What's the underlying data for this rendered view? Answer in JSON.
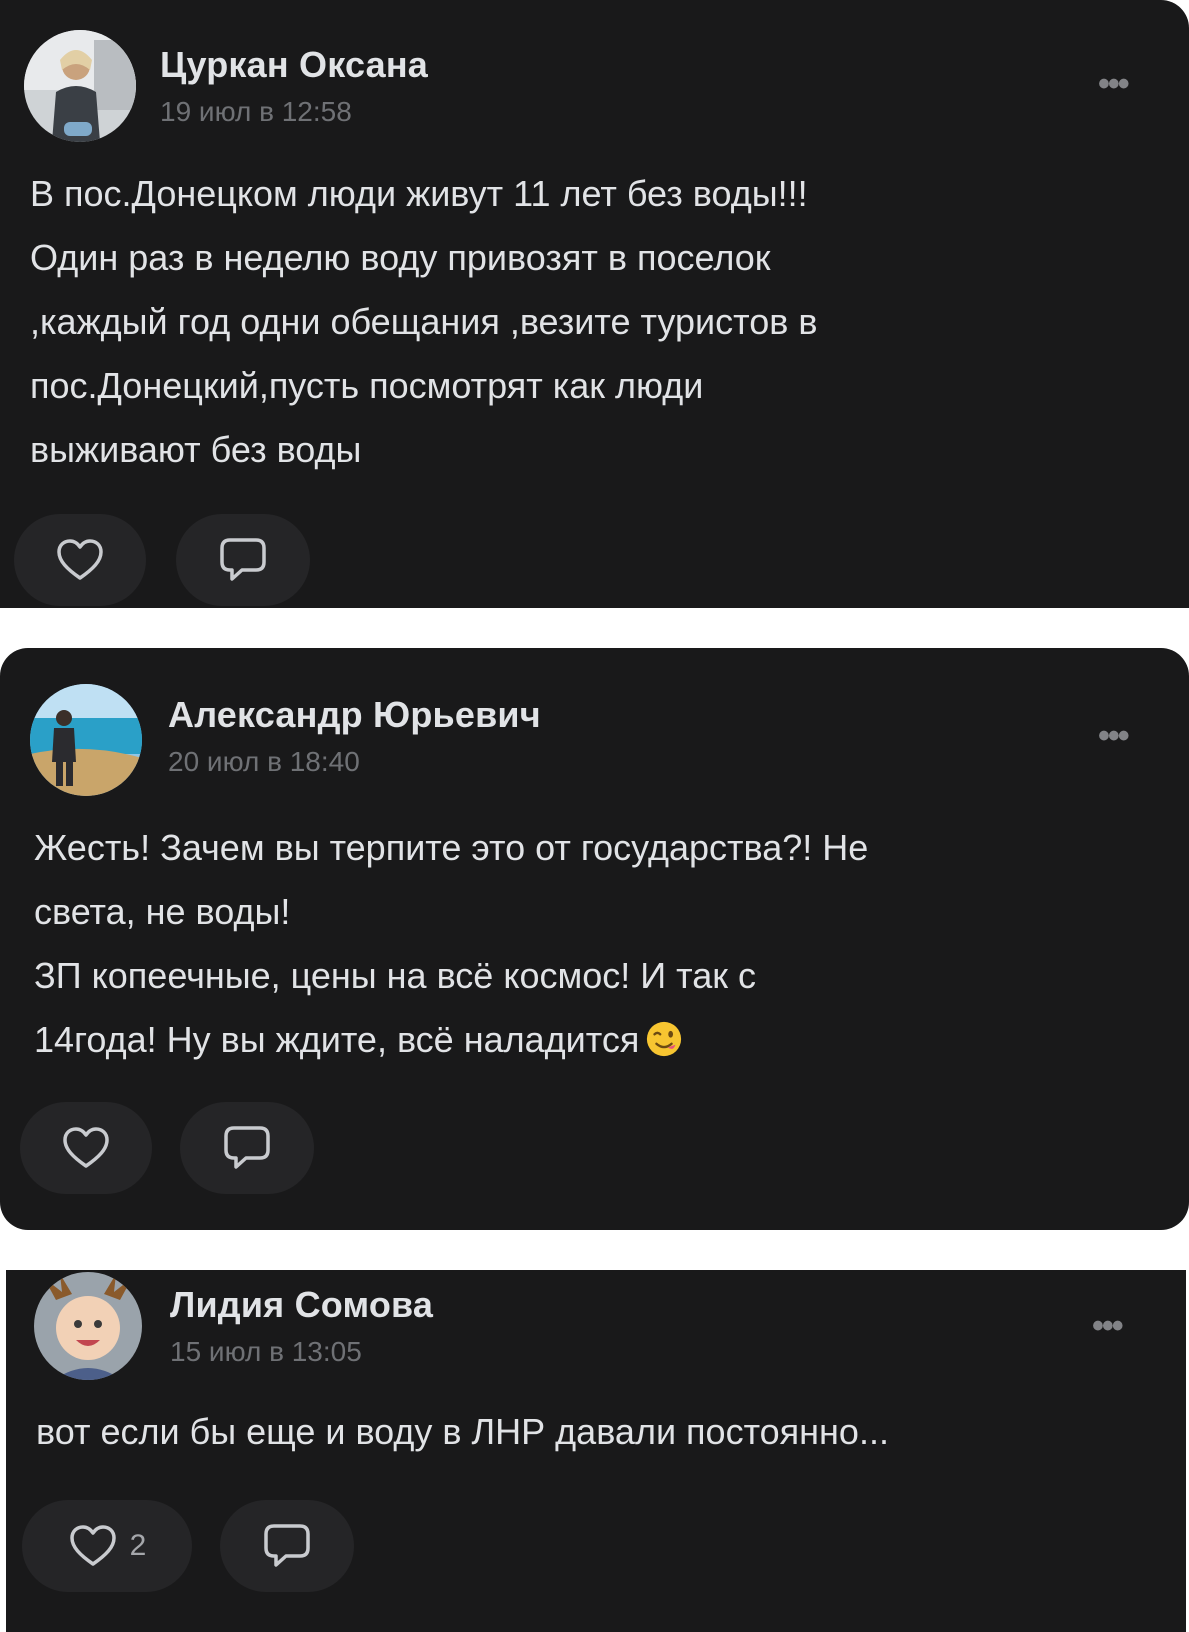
{
  "posts": [
    {
      "author": "Цуркан Оксана",
      "date": "19 июл в 12:58",
      "more_label": "•••",
      "text": "В пос.Донецком люди живут 11 лет без воды!!!\nОдин раз в неделю воду привозят в поселок\n,каждый год одни обещания ,везите туристов в\nпос.Донецкий,пусть посмотрят как люди\nвыживают без воды",
      "likes": ""
    },
    {
      "author": "Александр Юрьевич",
      "date": "20 июл в 18:40",
      "more_label": "•••",
      "text": "Жесть! Зачем вы терпите это от государства?! Не\nсвета, не воды!\nЗП копеечные, цены на всё космос! И так с\n14года! Ну вы ждите, всё наладится",
      "trailing_emoji": "wink-emoji",
      "likes": ""
    },
    {
      "author": "Лидия Сомова",
      "date": "15 июл в 13:05",
      "more_label": "•••",
      "text": "вот если бы еще и воду в ЛНР давали постоянно...",
      "likes": "2"
    }
  ],
  "icons": {
    "like": "heart-outline-icon",
    "comment": "speech-bubble-icon",
    "more": "ellipsis-icon"
  },
  "colors": {
    "card_background": "#19191a",
    "page_background": "#ffffff",
    "text_primary": "#e1e3e6",
    "text_secondary": "#6f7175",
    "button_background": "#252527"
  }
}
